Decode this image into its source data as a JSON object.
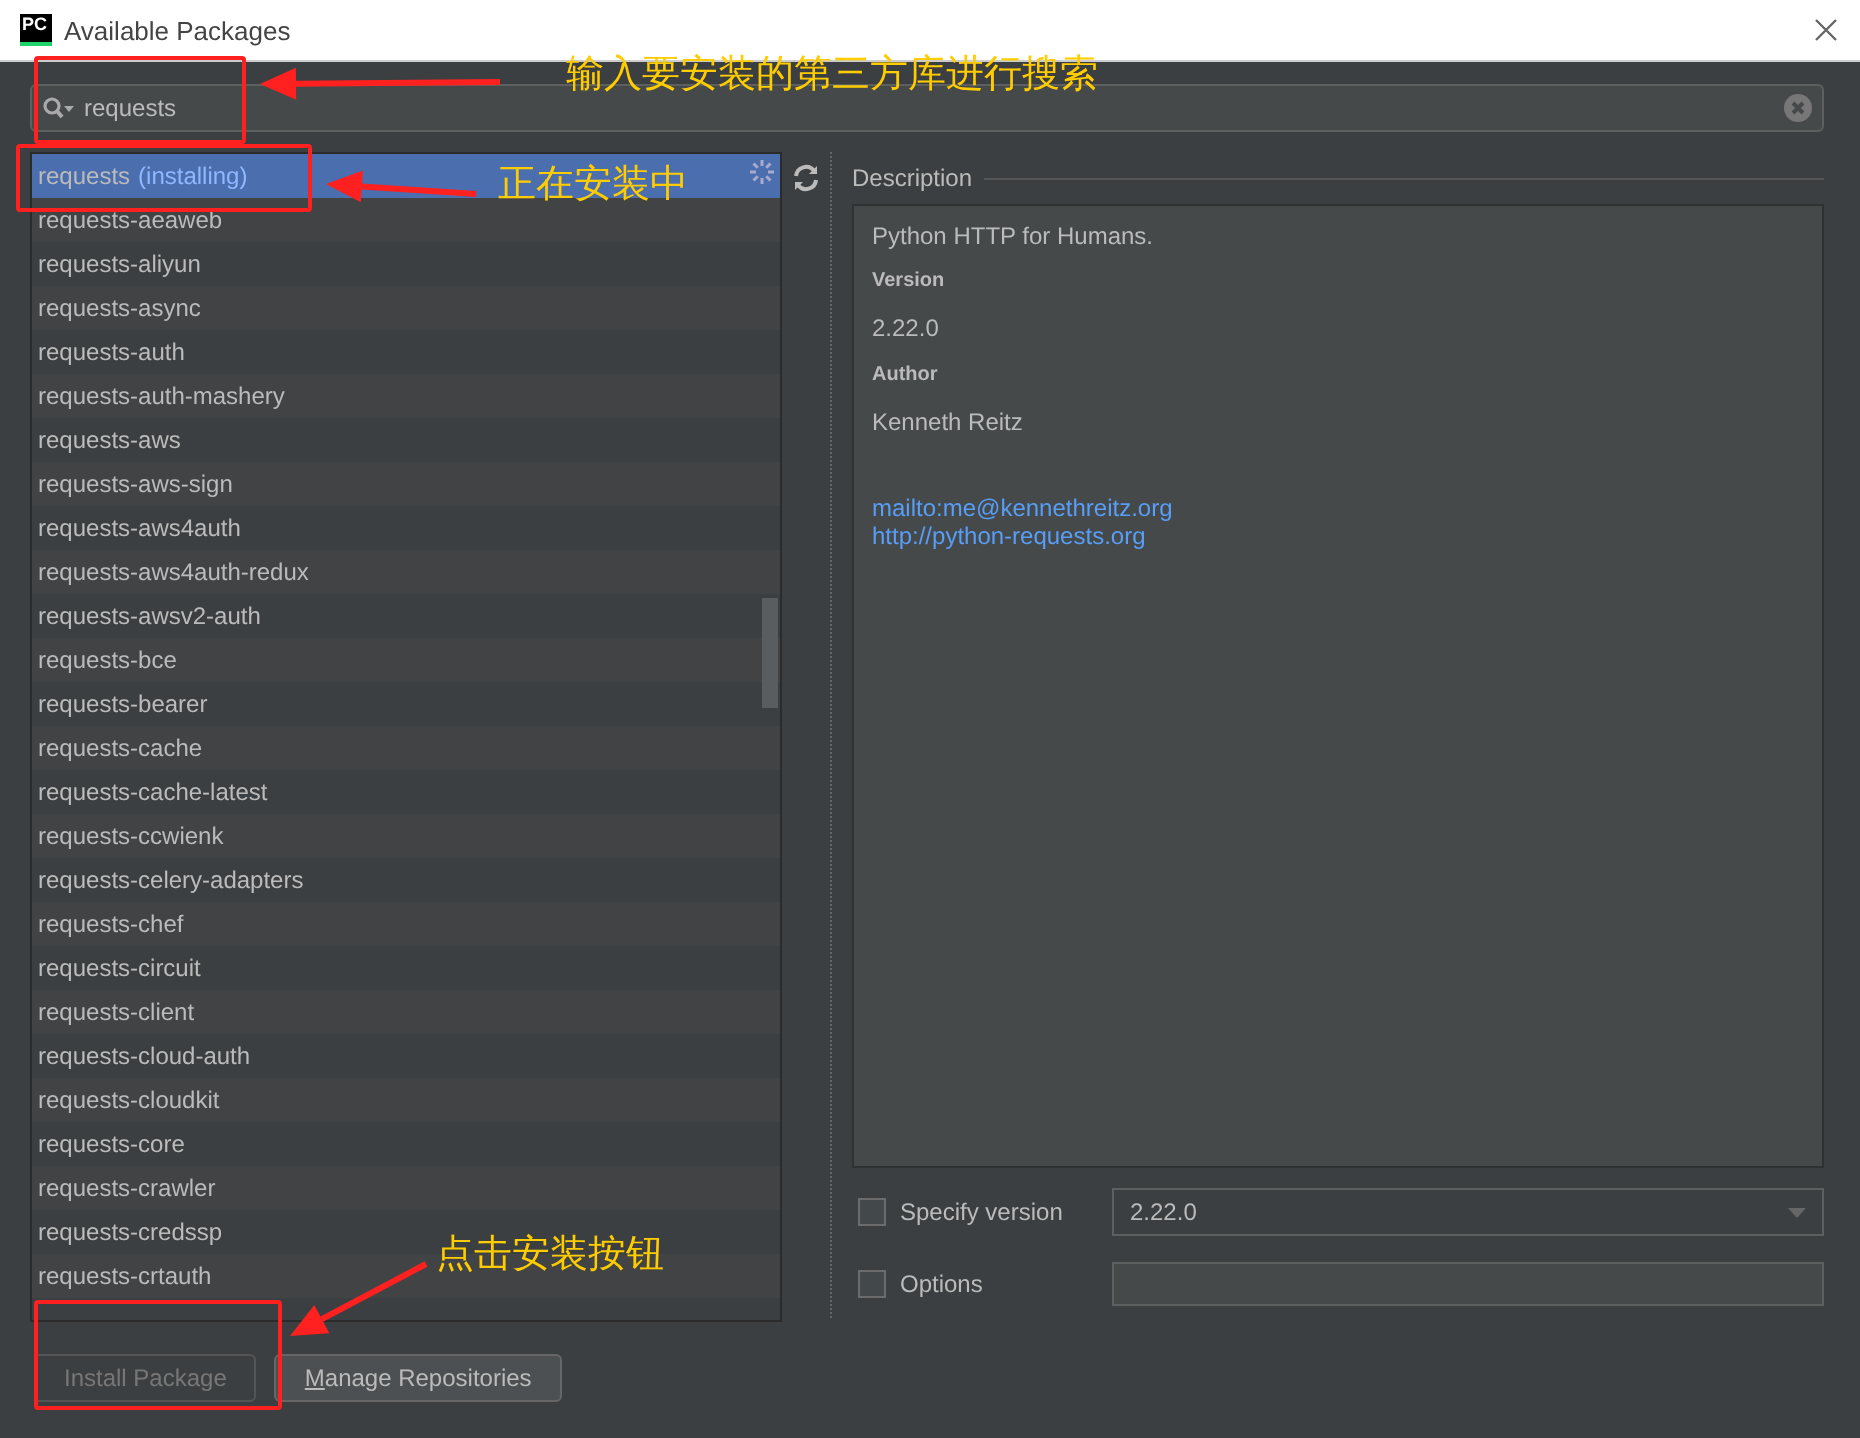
{
  "window": {
    "title": "Available Packages",
    "app_badge": "PC"
  },
  "search": {
    "value": "requests"
  },
  "packages": [
    {
      "name": "requests",
      "status": "(installing)",
      "selected": true
    },
    {
      "name": "requests-aeaweb",
      "selected": false
    },
    {
      "name": "requests-aliyun",
      "selected": false
    },
    {
      "name": "requests-async",
      "selected": false
    },
    {
      "name": "requests-auth",
      "selected": false
    },
    {
      "name": "requests-auth-mashery",
      "selected": false
    },
    {
      "name": "requests-aws",
      "selected": false
    },
    {
      "name": "requests-aws-sign",
      "selected": false
    },
    {
      "name": "requests-aws4auth",
      "selected": false
    },
    {
      "name": "requests-aws4auth-redux",
      "selected": false
    },
    {
      "name": "requests-awsv2-auth",
      "selected": false
    },
    {
      "name": "requests-bce",
      "selected": false
    },
    {
      "name": "requests-bearer",
      "selected": false
    },
    {
      "name": "requests-cache",
      "selected": false
    },
    {
      "name": "requests-cache-latest",
      "selected": false
    },
    {
      "name": "requests-ccwienk",
      "selected": false
    },
    {
      "name": "requests-celery-adapters",
      "selected": false
    },
    {
      "name": "requests-chef",
      "selected": false
    },
    {
      "name": "requests-circuit",
      "selected": false
    },
    {
      "name": "requests-client",
      "selected": false
    },
    {
      "name": "requests-cloud-auth",
      "selected": false
    },
    {
      "name": "requests-cloudkit",
      "selected": false
    },
    {
      "name": "requests-core",
      "selected": false
    },
    {
      "name": "requests-crawler",
      "selected": false
    },
    {
      "name": "requests-credssp",
      "selected": false
    },
    {
      "name": "requests-crtauth",
      "selected": false
    }
  ],
  "description": {
    "heading": "Description",
    "summary": "Python HTTP for Humans.",
    "fields": [
      {
        "label": "Version",
        "value": "2.22.0"
      },
      {
        "label": "Author",
        "value": "Kenneth Reitz"
      }
    ],
    "links": [
      "mailto:me@kennethreitz.org",
      "http://python-requests.org"
    ]
  },
  "options": [
    {
      "label": "Specify version",
      "checked": false,
      "value": "2.22.0",
      "kind": "dropdown"
    },
    {
      "label": "Options",
      "checked": false,
      "kind": "text"
    }
  ],
  "buttons": [
    {
      "label": "Install Package",
      "disabled": true
    },
    {
      "label": "Manage Repositories",
      "disabled": false
    }
  ],
  "annotations": [
    {
      "text": "输入要安装的第三方库进行搜索"
    },
    {
      "text": "正在安装中"
    },
    {
      "text": "点击安装按钮"
    }
  ]
}
